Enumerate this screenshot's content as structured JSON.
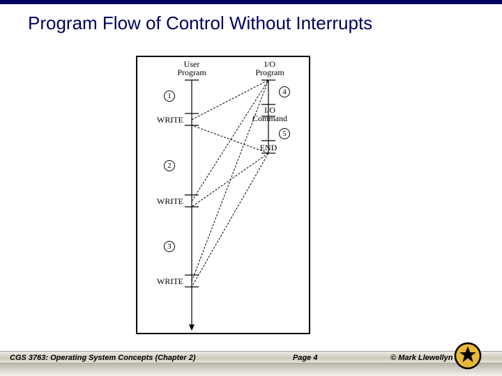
{
  "title": "Program Flow of Control Without Interrupts",
  "diagram": {
    "user_program_label": "User\nProgram",
    "io_program_label": "I/O\nProgram",
    "io_command_label": "I/O\nCommand",
    "end_label": "END",
    "write1": "WRITE",
    "write2": "WRITE",
    "write3": "WRITE",
    "n1": "1",
    "n2": "2",
    "n3": "3",
    "n4": "4",
    "n5": "5"
  },
  "footer": {
    "course": "CGS 3763: Operating System Concepts  (Chapter 2)",
    "page": "Page 4",
    "author": "© Mark Llewellyn"
  }
}
